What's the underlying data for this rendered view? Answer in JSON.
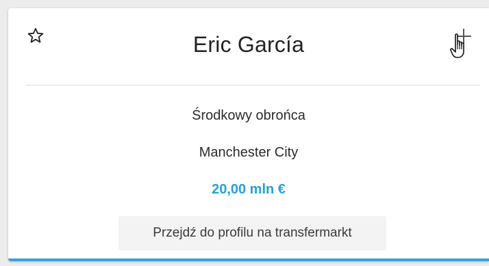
{
  "player_card": {
    "name": "Eric García",
    "position": "Środkowy obrońca",
    "club": "Manchester City",
    "market_value": "20,00 mln €",
    "profile_button_label": "Przejdź do profilu na transfermarkt",
    "icons": {
      "favorite": "star-outline-icon",
      "add": "plus-icon",
      "cursor": "hand-pointer-cursor-icon"
    },
    "colors": {
      "accent": "#2a9fd8",
      "card_border_bottom": "#3aa0dc"
    }
  }
}
